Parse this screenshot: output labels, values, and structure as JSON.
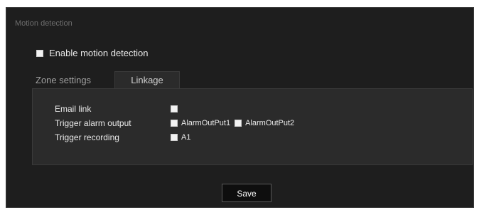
{
  "section_title": "Motion detection",
  "enable": {
    "label": "Enable motion detection",
    "checked": false
  },
  "tabs": [
    {
      "label": "Zone settings",
      "active": false
    },
    {
      "label": "Linkage",
      "active": true
    }
  ],
  "linkage": {
    "email": {
      "label": "Email link"
    },
    "alarm": {
      "label": "Trigger alarm output",
      "options": [
        "AlarmOutPut1",
        "AlarmOutPut2"
      ]
    },
    "recording": {
      "label": "Trigger recording",
      "options": [
        "A1"
      ]
    }
  },
  "save_label": "Save",
  "colors": {
    "background": "#1e1e1e",
    "tab_body": "#2b2b2b",
    "checkbox": "#f2f2f2"
  }
}
